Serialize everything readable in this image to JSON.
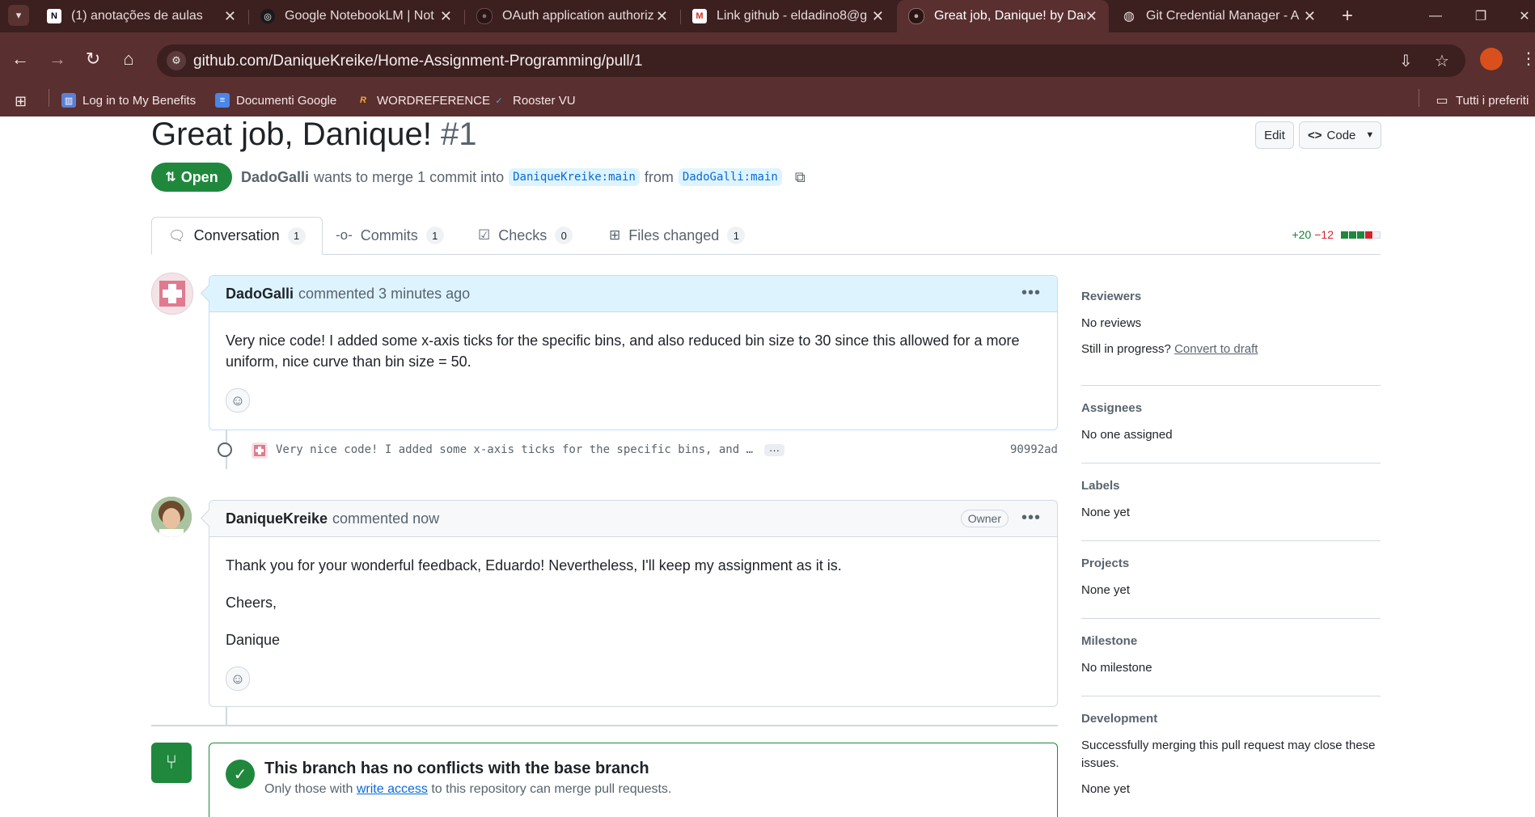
{
  "browser": {
    "tabs": [
      {
        "title": "(1) anotações de aulas",
        "icon": "notion-icon"
      },
      {
        "title": "Google NotebookLM | Not",
        "icon": "notebooklm-icon"
      },
      {
        "title": "OAuth application authoriz",
        "icon": "github-icon"
      },
      {
        "title": "Link github - eldadino8@g",
        "icon": "gmail-icon"
      },
      {
        "title": "Great job, Danique! by Dad",
        "icon": "github-icon",
        "active": true
      },
      {
        "title": "Git Credential Manager - A",
        "icon": "globe-icon"
      }
    ],
    "url": "github.com/DaniqueKreike/Home-Assignment-Programming/pull/1",
    "bookmarks": [
      {
        "label": "Log in to My Benefits"
      },
      {
        "label": "Documenti Google"
      },
      {
        "label": "WORDREFERENCE"
      },
      {
        "label": "Rooster VU"
      }
    ],
    "bookmarks_folder": "Tutti i preferiti"
  },
  "pr": {
    "title": "Great job, Danique!",
    "number": "#1",
    "edit_label": "Edit",
    "code_label": "Code",
    "state": "Open",
    "author": "DadoGalli",
    "merge_text": "wants to merge 1 commit into",
    "base_branch": "DaniqueKreike:main",
    "from_text": "from",
    "head_branch": "DadoGalli:main"
  },
  "tabs": [
    {
      "label": "Conversation",
      "count": "1",
      "icon": "comment-icon"
    },
    {
      "label": "Commits",
      "count": "1",
      "icon": "commit-icon"
    },
    {
      "label": "Checks",
      "count": "0",
      "icon": "checklist-icon"
    },
    {
      "label": "Files changed",
      "count": "1",
      "icon": "file-diff-icon"
    }
  ],
  "diffstat": {
    "additions": "+20",
    "deletions": "−12"
  },
  "comments": [
    {
      "author": "DadoGalli",
      "action": "commented 3 minutes ago",
      "body": [
        "Very nice code! I added some x-axis ticks for the specific bins, and also reduced bin size to 30 since this allowed for a more uniform, nice curve than bin size = 50."
      ]
    },
    {
      "author": "DaniqueKreike",
      "action": "commented now",
      "role": "Owner",
      "body": [
        "Thank you for your wonderful feedback, Eduardo! Nevertheless, I'll keep my assignment as it is.",
        "Cheers,",
        "Danique"
      ]
    }
  ],
  "commit": {
    "message": "Very nice code! I added some x-axis ticks for the specific bins, and …",
    "sha": "90992ad"
  },
  "merge": {
    "title": "This branch has no conflicts with the base branch",
    "sub_prefix": "Only those with",
    "sub_link": "write access",
    "sub_suffix": "to this repository can merge pull requests."
  },
  "sidebar": {
    "reviewers": {
      "heading": "Reviewers",
      "value": "No reviews",
      "progress_text": "Still in progress?",
      "draft_link": "Convert to draft"
    },
    "assignees": {
      "heading": "Assignees",
      "value": "No one assigned"
    },
    "labels": {
      "heading": "Labels",
      "value": "None yet"
    },
    "projects": {
      "heading": "Projects",
      "value": "None yet"
    },
    "milestone": {
      "heading": "Milestone",
      "value": "No milestone"
    },
    "development": {
      "heading": "Development",
      "text": "Successfully merging this pull request may close these issues.",
      "value": "None yet"
    }
  },
  "colors": {
    "open_green": "#1f883d",
    "link_blue": "#0969da",
    "chrome_dark": "#3c1f1f",
    "chrome_toolbar": "#5a2f2f"
  }
}
